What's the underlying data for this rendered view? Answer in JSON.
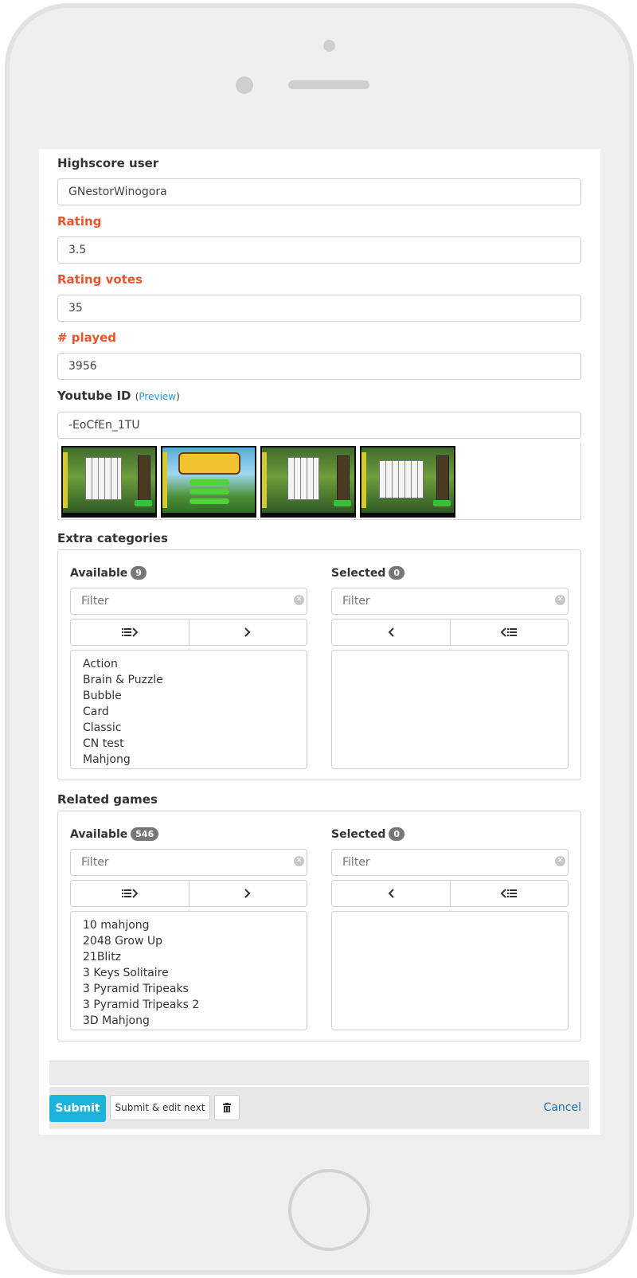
{
  "form": {
    "highscore_user": {
      "label": "Highscore user",
      "value": "GNestorWinogora"
    },
    "rating": {
      "label": "Rating",
      "value": "3.5"
    },
    "rating_votes": {
      "label": "Rating votes",
      "value": "35"
    },
    "played": {
      "label": "# played",
      "value": "3956"
    },
    "youtube": {
      "label": "Youtube ID",
      "paren_open": "(",
      "preview_link": "Preview",
      "paren_close": ")",
      "value": "-EoCfEn_1TU"
    }
  },
  "screenshots": [
    "mahjong-board-thumbnail",
    "jungle-connect-splash-thumbnail",
    "mahjong-board-thumbnail",
    "mahjong-board-thumbnail"
  ],
  "extra_categories": {
    "title": "Extra categories",
    "available": {
      "label": "Available",
      "count": "9",
      "filter_placeholder": "Filter",
      "items": [
        "Action",
        "Brain & Puzzle",
        "Bubble",
        "Card",
        "Classic",
        "CN test",
        "Mahjong"
      ]
    },
    "selected": {
      "label": "Selected",
      "count": "0",
      "filter_placeholder": "Filter",
      "items": []
    }
  },
  "related_games": {
    "title": "Related games",
    "available": {
      "label": "Available",
      "count": "546",
      "filter_placeholder": "Filter",
      "items": [
        "10 mahjong",
        "2048 Grow Up",
        "21Blitz",
        "3 Keys Solitaire",
        "3 Pyramid Tripeaks",
        "3 Pyramid Tripeaks 2",
        "3D Mahjong"
      ]
    },
    "selected": {
      "label": "Selected",
      "count": "0",
      "filter_placeholder": "Filter",
      "items": []
    }
  },
  "footer": {
    "submit": "Submit",
    "submit_next": "Submit & edit next",
    "delete_icon": "trash-icon",
    "cancel": "Cancel"
  },
  "colors": {
    "required_label": "#e8552d",
    "submit": "#1bb3d9",
    "link": "#1a9bd7",
    "badge": "#777777"
  }
}
